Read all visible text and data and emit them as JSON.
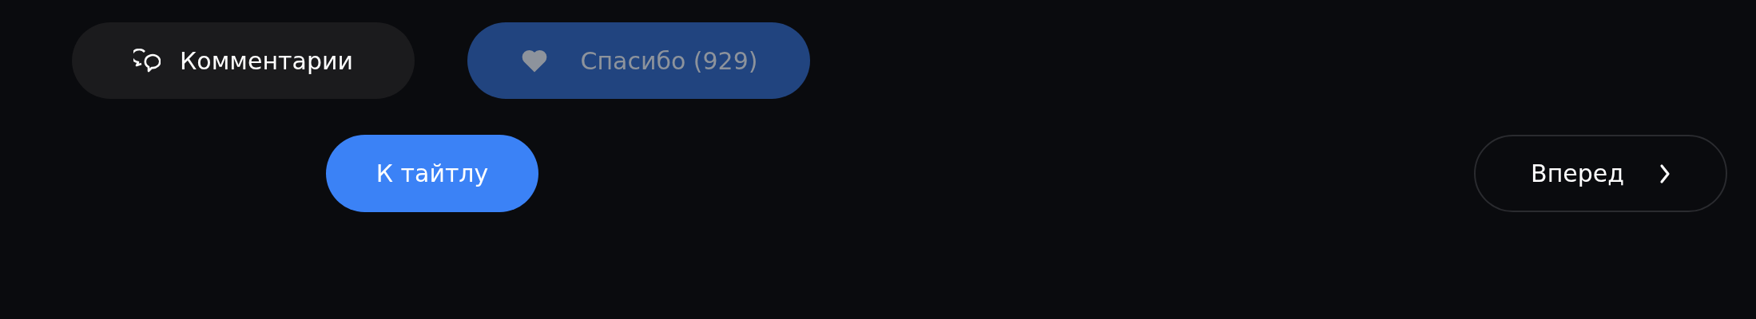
{
  "actions": {
    "comments": {
      "label": "Комментарии"
    },
    "thanks": {
      "label": "Спасибо (929)",
      "disabled": true
    }
  },
  "navigation": {
    "title_link": {
      "label": "К тайтлу"
    },
    "next": {
      "label": "Вперед"
    }
  }
}
